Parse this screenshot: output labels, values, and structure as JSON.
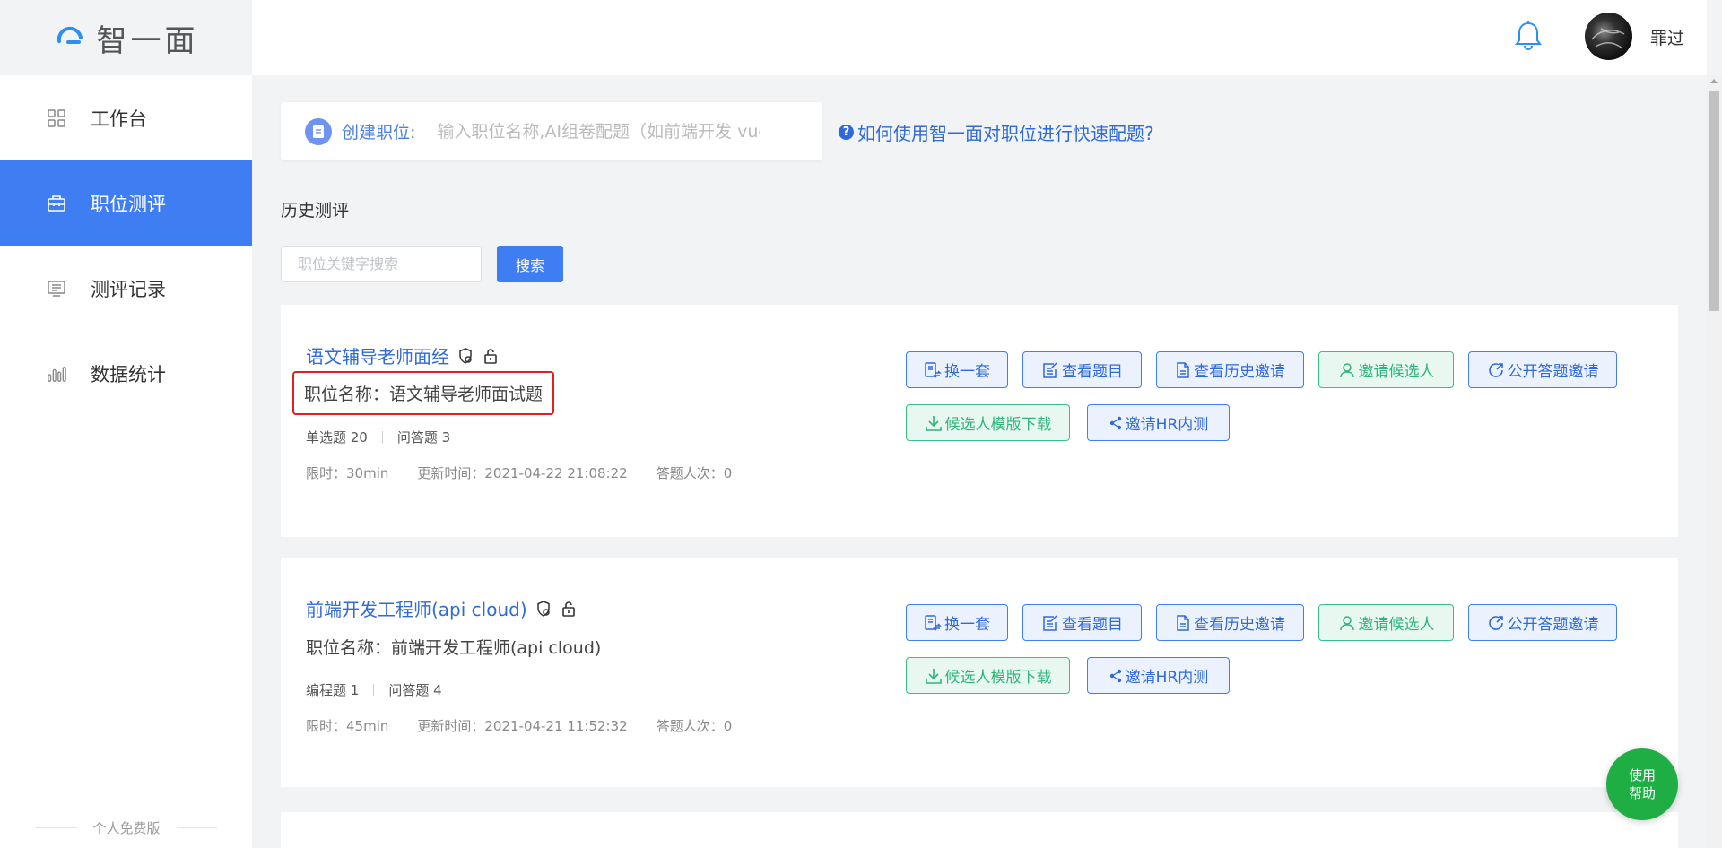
{
  "app": {
    "logo_text": "智一面"
  },
  "sidebar": {
    "items": [
      {
        "label": "工作台",
        "icon": "grid-icon",
        "active": false
      },
      {
        "label": "职位测评",
        "icon": "briefcase-icon",
        "active": true
      },
      {
        "label": "测评记录",
        "icon": "record-list-icon",
        "active": false
      },
      {
        "label": "数据统计",
        "icon": "bar-chart-icon",
        "active": false
      }
    ],
    "footer": "个人免费版"
  },
  "header": {
    "username": "罪过",
    "bell_icon": "bell-icon"
  },
  "create": {
    "label": "创建职位:",
    "placeholder": "输入职位名称,AI组卷配题（如前端开发 vue)"
  },
  "help_link": "如何使用智一面对职位进行快速配题?",
  "history": {
    "title": "历史测评",
    "search_placeholder": "职位关键字搜索",
    "search_button": "搜索"
  },
  "buttons": {
    "change": "换一套",
    "view_questions": "查看题目",
    "view_history": "查看历史邀请",
    "invite_candidate": "邀请候选人",
    "public_invite": "公开答题邀请",
    "template_download": "候选人模版下载",
    "invite_hr": "邀请HR内测"
  },
  "cards": [
    {
      "title": "语文辅导老师面经",
      "job_name": "职位名称：语文辅导老师面试题",
      "count1": "单选题 20",
      "count2": "问答题 3",
      "limit": "限时：30min",
      "updated": "更新时间：2021-04-22 21:08:22",
      "answers": "答题人次：0"
    },
    {
      "title": "前端开发工程师(api cloud)",
      "job_name": "职位名称：前端开发工程师(api cloud)",
      "count1": "编程题 1",
      "count2": "问答题 4",
      "limit": "限时：45min",
      "updated": "更新时间：2021-04-21 11:52:32",
      "answers": "答题人次：0"
    }
  ],
  "help_fab": {
    "line1": "使用",
    "line2": "帮助"
  },
  "colors": {
    "primary": "#3f7df2",
    "link": "#2f6ad8",
    "success": "#2eb57b",
    "fab": "#1fae44",
    "highlight_border": "#e02020"
  }
}
